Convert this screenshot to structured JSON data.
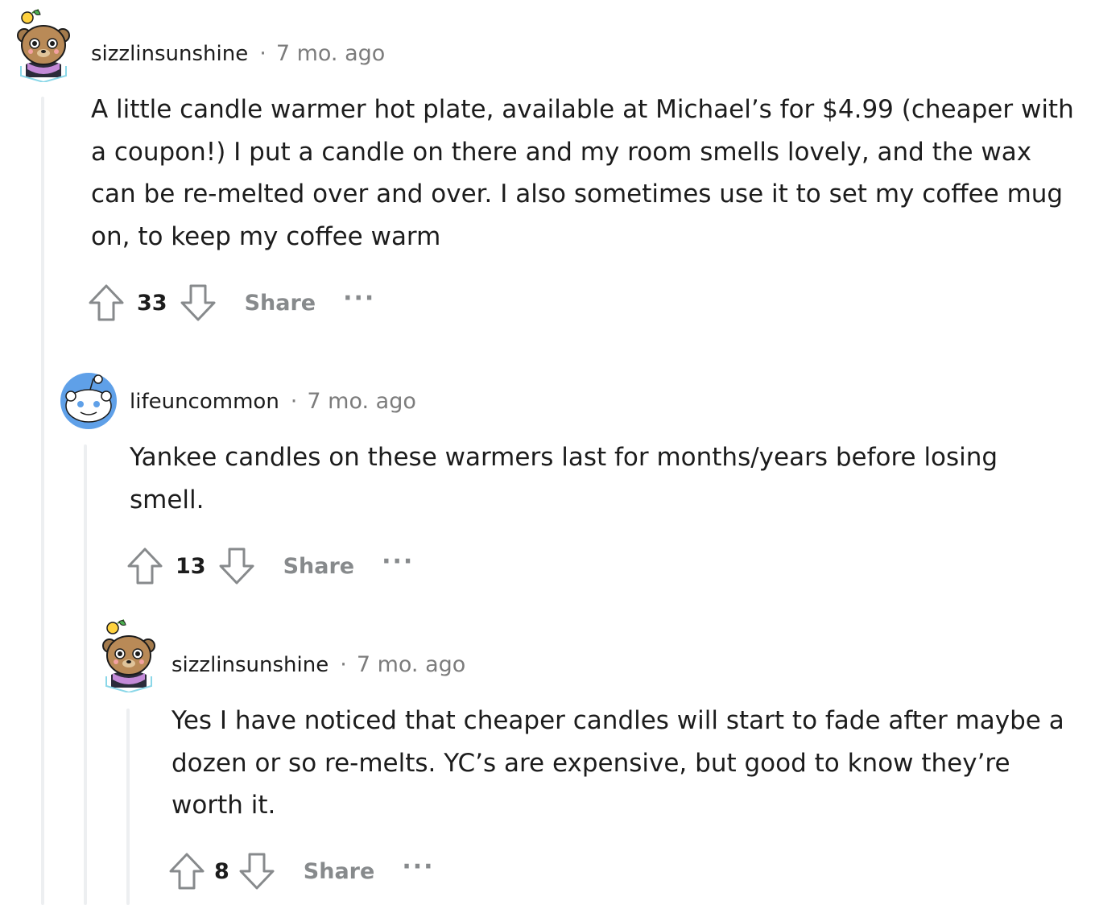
{
  "comments": [
    {
      "author": "sizzlinsunshine",
      "separator": "·",
      "time": "7 mo. ago",
      "body": "A little candle warmer hot plate, available at Michael’s for $4.99 (cheaper with a coupon!) I put a candle on there and my room smells lovely, and the wax can be re-melted over and over. I also sometimes use it to set my coffee mug on, to keep my coffee warm",
      "score": "33",
      "share_label": "Share",
      "more_label": "···",
      "avatar_icon": "bear-avatar-icon"
    },
    {
      "author": "lifeuncommon",
      "separator": "·",
      "time": "7 mo. ago",
      "body": "Yankee candles on these warmers last for months/years before losing smell.",
      "score": "13",
      "share_label": "Share",
      "more_label": "···",
      "avatar_icon": "snoo-avatar-icon"
    },
    {
      "author": "sizzlinsunshine",
      "separator": "·",
      "time": "7 mo. ago",
      "body": "Yes I have noticed that cheaper candles will start to fade after maybe a dozen or so re-melts. YC’s are expensive, but good to know they’re worth it.",
      "score": "8",
      "share_label": "Share",
      "more_label": "···",
      "avatar_icon": "bear-avatar-icon"
    }
  ],
  "colors": {
    "text": "#1c1c1c",
    "meta": "#7c7c7c",
    "action": "#878a8c",
    "thread_line": "#edeff1",
    "snoo_blue": "#5fa0e8"
  }
}
